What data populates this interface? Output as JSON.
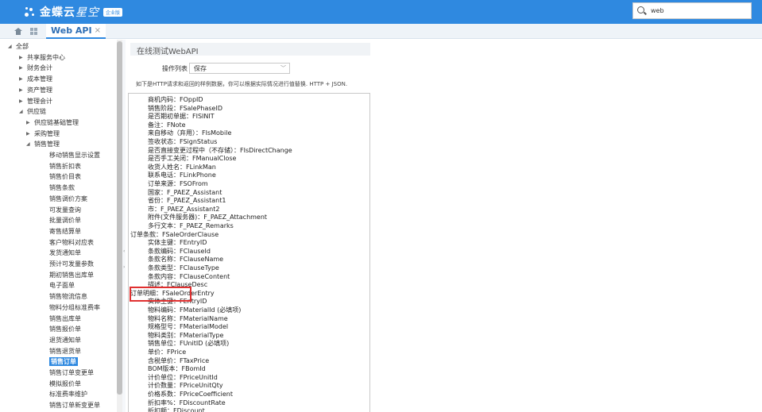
{
  "topbar": {
    "brand": "金蝶云",
    "brand_suffix": "星空",
    "edition_badge": "企业版",
    "search_value": "web",
    "accent_color": "#2f89e0"
  },
  "tabs": [
    {
      "label": "Web API",
      "close": "×"
    }
  ],
  "sidebar": {
    "items": [
      {
        "label": "全部",
        "arrow": "◢",
        "level": 0
      },
      {
        "label": "共享服务中心",
        "arrow": "▶",
        "level": 1
      },
      {
        "label": "财务会计",
        "arrow": "▶",
        "level": 1
      },
      {
        "label": "成本管理",
        "arrow": "▶",
        "level": 1
      },
      {
        "label": "资产管理",
        "arrow": "▶",
        "level": 1
      },
      {
        "label": "管理会计",
        "arrow": "▶",
        "level": 1
      },
      {
        "label": "供应链",
        "arrow": "◢",
        "level": 1
      },
      {
        "label": "供应链基础管理",
        "arrow": "▶",
        "level": 2
      },
      {
        "label": "采购管理",
        "arrow": "▶",
        "level": 2
      },
      {
        "label": "销售管理",
        "arrow": "◢",
        "level": 2
      },
      {
        "label": "移动销售显示设置",
        "arrow": "",
        "level": 3
      },
      {
        "label": "销售折扣表",
        "arrow": "",
        "level": 3
      },
      {
        "label": "销售价目表",
        "arrow": "",
        "level": 3
      },
      {
        "label": "销售条款",
        "arrow": "",
        "level": 3
      },
      {
        "label": "销售调价方案",
        "arrow": "",
        "level": 3
      },
      {
        "label": "可发量查询",
        "arrow": "",
        "level": 3
      },
      {
        "label": "批量调价单",
        "arrow": "",
        "level": 3
      },
      {
        "label": "寄售结算单",
        "arrow": "",
        "level": 3
      },
      {
        "label": "客户物料对应表",
        "arrow": "",
        "level": 3
      },
      {
        "label": "发货通知单",
        "arrow": "",
        "level": 3
      },
      {
        "label": "预计可发量参数",
        "arrow": "",
        "level": 3
      },
      {
        "label": "期初销售出库单",
        "arrow": "",
        "level": 3
      },
      {
        "label": "电子面单",
        "arrow": "",
        "level": 3
      },
      {
        "label": "销售物流信息",
        "arrow": "",
        "level": 3
      },
      {
        "label": "物料分组标准费率",
        "arrow": "",
        "level": 3
      },
      {
        "label": "销售出库单",
        "arrow": "",
        "level": 3
      },
      {
        "label": "销售报价单",
        "arrow": "",
        "level": 3
      },
      {
        "label": "退货通知单",
        "arrow": "",
        "level": 3
      },
      {
        "label": "销售退货单",
        "arrow": "",
        "level": 3
      },
      {
        "label": "销售订单",
        "arrow": "",
        "level": 3,
        "selected": true
      },
      {
        "label": "销售订单变更单",
        "arrow": "",
        "level": 3
      },
      {
        "label": "模拟报价单",
        "arrow": "",
        "level": 3
      },
      {
        "label": "标准费率维护",
        "arrow": "",
        "level": 3
      },
      {
        "label": "销售订单新变更单",
        "arrow": "",
        "level": 3
      }
    ]
  },
  "main": {
    "title": "在线测试WebAPI",
    "op_label": "操作列表",
    "op_value": "保存",
    "hint": "如下是HTTP请求和返回的样例数据，你可以根据实际情况进行值替换. HTTP + JSON.",
    "lines": [
      {
        "text": "商机内码：FOppID",
        "indent": 1
      },
      {
        "text": "销售阶段：FSalePhaseID",
        "indent": 1
      },
      {
        "text": "是否期初单据：FISINIT",
        "indent": 1
      },
      {
        "text": "备注：FNote",
        "indent": 1
      },
      {
        "text": "来自移动（弃用）：FIsMobile",
        "indent": 1
      },
      {
        "text": "签收状态：FSignStatus",
        "indent": 1
      },
      {
        "text": "是否直接变更过程中（不存储）：FIsDirectChange",
        "indent": 1
      },
      {
        "text": "是否手工关闭：FManualClose",
        "indent": 1
      },
      {
        "text": "收货人姓名：FLinkMan",
        "indent": 1
      },
      {
        "text": "联系电话：FLinkPhone",
        "indent": 1
      },
      {
        "text": "订单来源：FSOFrom",
        "indent": 1
      },
      {
        "text": "国家：F_PAEZ_Assistant",
        "indent": 1
      },
      {
        "text": "省份：F_PAEZ_Assistant1",
        "indent": 1
      },
      {
        "text": "市：F_PAEZ_Assistant2",
        "indent": 1
      },
      {
        "text": "附件(文件服务器)：F_PAEZ_Attachment",
        "indent": 1
      },
      {
        "text": "多行文本：F_PAEZ_Remarks",
        "indent": 1
      },
      {
        "text": "订单条款：FSaleOrderClause",
        "indent": 0
      },
      {
        "text": "实体主键：FEntryID",
        "indent": 1
      },
      {
        "text": "条款编码：FClauseId",
        "indent": 1
      },
      {
        "text": "条款名称：FClauseName",
        "indent": 1
      },
      {
        "text": "条款类型：FClauseType",
        "indent": 1
      },
      {
        "text": "条款内容：FClauseContent",
        "indent": 1
      },
      {
        "text": "描述：FClauseDesc",
        "indent": 1
      },
      {
        "text": "订单明细：FSaleOrderEntry",
        "indent": 0
      },
      {
        "text": "实体主键：FEntryID",
        "indent": 1
      },
      {
        "text": "物料编码：FMaterialId (必填项)",
        "indent": 1
      },
      {
        "text": "物料名称：FMaterialName",
        "indent": 1
      },
      {
        "text": "规格型号：FMaterialModel",
        "indent": 1
      },
      {
        "text": "物料类别：FMaterialType",
        "indent": 1
      },
      {
        "text": "销售单位：FUnitID (必填项)",
        "indent": 1
      },
      {
        "text": "单价：FPrice",
        "indent": 1
      },
      {
        "text": "含税单价：FTaxPrice",
        "indent": 1
      },
      {
        "text": "BOM版本：FBomId",
        "indent": 1
      },
      {
        "text": "计价单位：FPriceUnitId",
        "indent": 1
      },
      {
        "text": "计价数量：FPriceUnitQty",
        "indent": 1
      },
      {
        "text": "价格系数：FPriceCoefficient",
        "indent": 1
      },
      {
        "text": "折扣率%：FDiscountRate",
        "indent": 1
      },
      {
        "text": "折扣额：FDiscount",
        "indent": 1
      }
    ]
  }
}
